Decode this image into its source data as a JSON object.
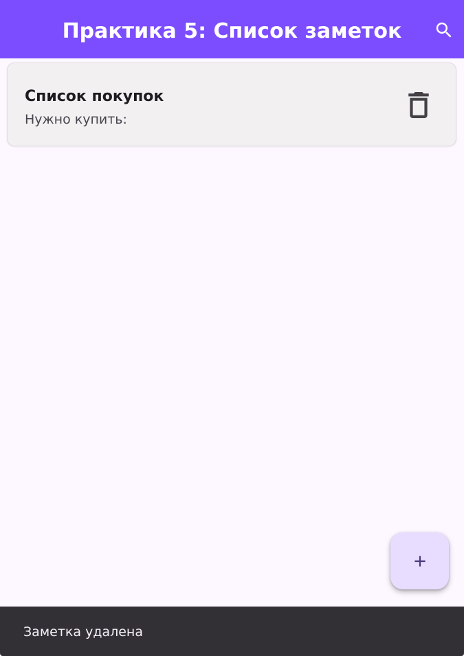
{
  "app_bar": {
    "title": "Практика 5: Список заметок",
    "background_color": "#7c4dff",
    "action_icon": "search-icon"
  },
  "notes": [
    {
      "title": "Список покупок",
      "subtitle": "Нужно купить:",
      "action_icon": "delete-icon"
    }
  ],
  "fab": {
    "icon": "plus-icon",
    "background_color": "#e8ddff"
  },
  "snackbar": {
    "message": "Заметка удалена"
  },
  "colors": {
    "page_background": "#fdf7ff",
    "card_background": "#f2f0f0",
    "snackbar_background": "#322f35"
  }
}
